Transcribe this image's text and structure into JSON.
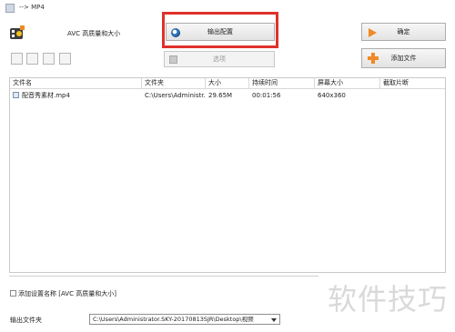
{
  "window": {
    "title": "--> MP4"
  },
  "preset": {
    "label": "AVC 高质量和大小"
  },
  "toolbar": {
    "output_config_label": "输出配置",
    "options_label": "选项",
    "ok_label": "确定",
    "add_file_label": "添加文件"
  },
  "table": {
    "headers": [
      "文件名",
      "文件夹",
      "大小",
      "持续时间",
      "屏幕大小",
      "截取片断"
    ],
    "rows": [
      {
        "filename": "配音秀素材.mp4",
        "folder": "C:\\Users\\Administr...",
        "size": "29.65M",
        "duration": "00:01:56",
        "screen_size": "640x360",
        "clip": ""
      }
    ]
  },
  "add_preset_name": {
    "label": "添加设置名称 [AVC 高质量和大小]",
    "checked": false
  },
  "output_folder": {
    "label": "输出文件夹",
    "value": "C:\\Users\\Administrator.SKY-20170813SJR\\Desktop\\视频"
  },
  "watermark": {
    "text": "软件技巧"
  },
  "colors": {
    "highlight": "#e0312b",
    "accent_icon": "#f08a24"
  },
  "icons": [
    "app-icon",
    "preset-film-icon",
    "output-config-icon",
    "options-icon",
    "ok-arrow-icon",
    "add-plus-icon",
    "file-icon",
    "dropdown-arrow-icon"
  ]
}
